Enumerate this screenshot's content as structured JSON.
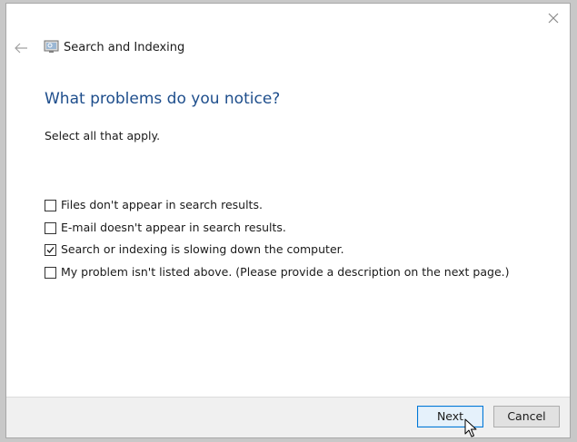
{
  "window": {
    "title": "Search and Indexing"
  },
  "page": {
    "heading": "What problems do you notice?",
    "instruction": "Select all that apply."
  },
  "options": [
    {
      "label": "Files don't appear in search results.",
      "checked": false
    },
    {
      "label": "E-mail doesn't appear in search results.",
      "checked": false
    },
    {
      "label": "Search or indexing is slowing down the computer.",
      "checked": true
    },
    {
      "label": "My problem isn't listed above. (Please provide a description on the next page.)",
      "checked": false
    }
  ],
  "footer": {
    "next_label": "Next",
    "cancel_label": "Cancel"
  },
  "icons": {
    "close": "close-icon",
    "back": "back-arrow-icon",
    "app": "search-indexing-icon",
    "check": "checkmark-icon",
    "cursor": "mouse-pointer-icon"
  },
  "colors": {
    "heading": "#1e4e8c",
    "primary_button_border": "#0078d7",
    "primary_button_bg": "#e5f1fb",
    "footer_bg": "#f0f0f0"
  }
}
